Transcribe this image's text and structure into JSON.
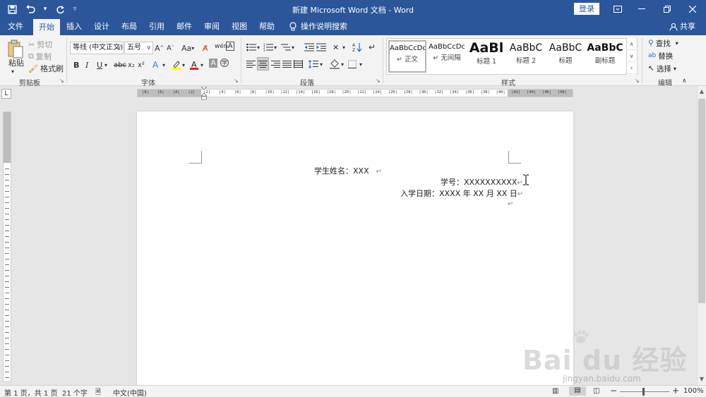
{
  "titlebar": {
    "title": "新建 Microsoft Word 文档 - Word",
    "login_label": "登录",
    "bg_color": "#2b579a"
  },
  "tabs": [
    {
      "label": "文件"
    },
    {
      "label": "开始"
    },
    {
      "label": "插入"
    },
    {
      "label": "设计"
    },
    {
      "label": "布局"
    },
    {
      "label": "引用"
    },
    {
      "label": "邮件"
    },
    {
      "label": "审阅"
    },
    {
      "label": "视图"
    },
    {
      "label": "帮助"
    }
  ],
  "tell_me": "操作说明搜索",
  "share_label": "共享",
  "clipboard": {
    "paste": "粘贴",
    "cut": "剪切",
    "copy": "复制",
    "format_painter": "格式刷",
    "group_label": "剪贴板"
  },
  "font": {
    "font_name": "等线 (中文正文)",
    "font_size": "五号",
    "aa_label": "Aa",
    "group_label": "字体"
  },
  "paragraph": {
    "group_label": "段落"
  },
  "styles": {
    "items": [
      {
        "preview": "AaBbCcDc",
        "name": "正文",
        "selected": true
      },
      {
        "preview": "AaBbCcDc",
        "name": "无间隔",
        "selected": false
      },
      {
        "preview": "AaBl",
        "name": "标题 1",
        "selected": false
      },
      {
        "preview": "AaBbC",
        "name": "标题 2",
        "selected": false
      },
      {
        "preview": "AaBbC",
        "name": "标题",
        "selected": false
      },
      {
        "preview": "AaBbC",
        "name": "副标题",
        "selected": false
      }
    ],
    "group_label": "样式"
  },
  "editing": {
    "find": "查找",
    "replace": "替换",
    "select": "选择",
    "group_label": "编辑"
  },
  "ruler_corner": "L",
  "ruler_ticks": [
    "8",
    "6",
    "4",
    "2",
    "2",
    "4",
    "6",
    "8",
    "10",
    "12",
    "14",
    "16",
    "18",
    "20",
    "22",
    "24",
    "26",
    "28",
    "30",
    "32",
    "34",
    "36",
    "38",
    "40",
    "42",
    "44",
    "46",
    "48"
  ],
  "document": {
    "line1": "学生姓名：XXX",
    "line2": "学号：XXXXXXXXXX",
    "line3": "入学日期：XXXX 年 XX 月 XX 日",
    "para_mark": "↵"
  },
  "status": {
    "page": "第 1 页，共 1 页",
    "words": "21 个字",
    "lang": "中文(中国)",
    "zoom": "100%"
  },
  "watermark": {
    "text": "Bai du 经验",
    "url": "jingyan.baidu.com"
  }
}
